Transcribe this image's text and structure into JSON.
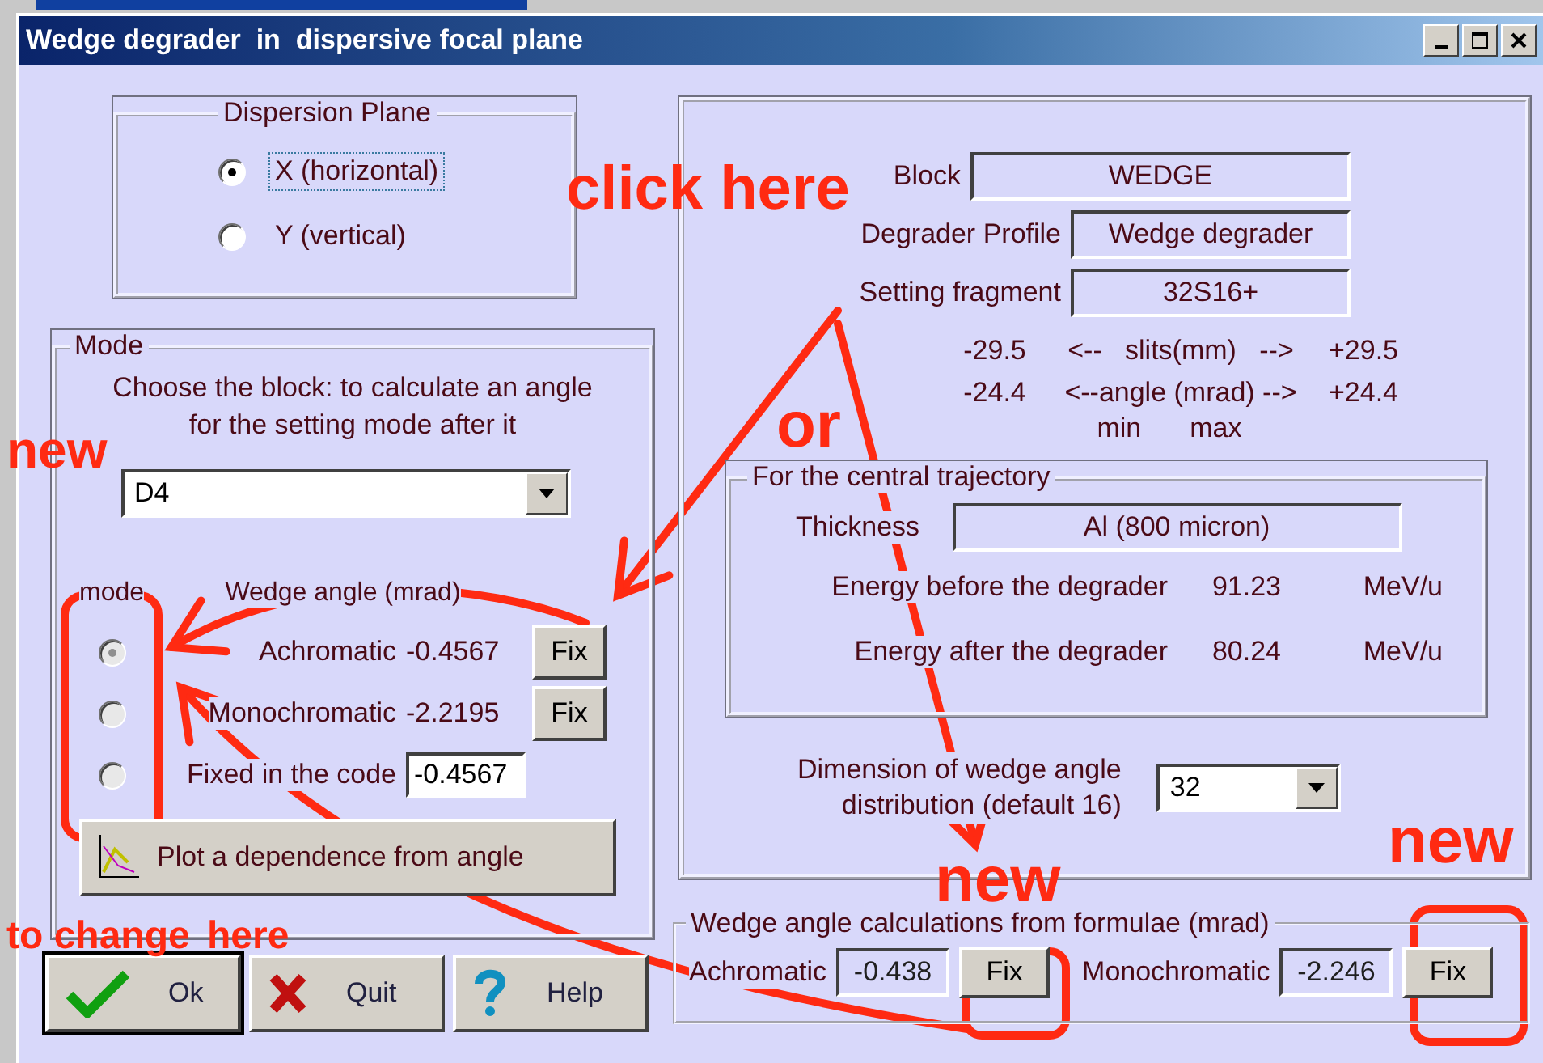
{
  "window": {
    "title": "Wedge degrader  in  dispersive focal plane"
  },
  "dispersion_plane": {
    "title": "Dispersion Plane",
    "options": [
      {
        "label": "X (horizontal)",
        "selected": true
      },
      {
        "label": "Y (vertical)",
        "selected": false
      }
    ]
  },
  "mode": {
    "title": "Mode",
    "instruction": "Choose the block: to calculate an angle for the setting mode after it",
    "block_select": {
      "value": "D4"
    },
    "mode_header": "mode",
    "angle_header": "Wedge angle (mrad)",
    "rows": [
      {
        "kind": "button",
        "label": "Achromatic",
        "value": "-0.4567",
        "action": "Fix",
        "selected": true,
        "disabled": true
      },
      {
        "kind": "button",
        "label": "Monochromatic",
        "value": "-2.2195",
        "action": "Fix",
        "selected": false,
        "disabled": true
      },
      {
        "kind": "input",
        "label": "Fixed in the code",
        "value": "-0.4567",
        "selected": false,
        "disabled": true
      }
    ],
    "plot_button": "Plot a dependence from angle"
  },
  "info": {
    "fields": [
      {
        "label": "Block",
        "value": "WEDGE",
        "wide": true
      },
      {
        "label": "Degrader Profile",
        "value": "Wedge degrader",
        "wide": false
      },
      {
        "label": "Setting fragment",
        "value": "32S16+",
        "wide": false
      }
    ],
    "ranges": [
      {
        "min": "-29.5",
        "label": "<--   slits(mm)   -->",
        "max": "+29.5"
      },
      {
        "min": "-24.4",
        "label": "<--angle (mrad) -->",
        "max": "+24.4"
      }
    ],
    "min_label": "min",
    "max_label": "max",
    "central": {
      "title": "For the central trajectory",
      "thickness_label": "Thickness",
      "thickness": "Al (800 micron)",
      "energies": [
        {
          "label": "Energy before the degrader",
          "value": "91.23",
          "unit": "MeV/u"
        },
        {
          "label": "Energy after the degrader",
          "value": "80.24",
          "unit": "MeV/u"
        }
      ]
    },
    "dimension": {
      "label_lines": [
        "Dimension of wedge angle",
        "distribution  (default 16)"
      ],
      "value": "32"
    }
  },
  "formulae": {
    "title": "Wedge angle calculations from formulae (mrad)",
    "items": [
      {
        "label": "Achromatic",
        "value": "-0.438",
        "action": "Fix"
      },
      {
        "label": "Monochromatic",
        "value": "-2.246",
        "action": "Fix"
      }
    ]
  },
  "buttons": [
    {
      "kind": "ok",
      "label": "Ok"
    },
    {
      "kind": "quit",
      "label": "Quit"
    },
    {
      "kind": "help",
      "label": "Help"
    }
  ],
  "annotations": [
    "click here",
    "or",
    "new",
    "to change",
    "here",
    "new",
    "new"
  ]
}
